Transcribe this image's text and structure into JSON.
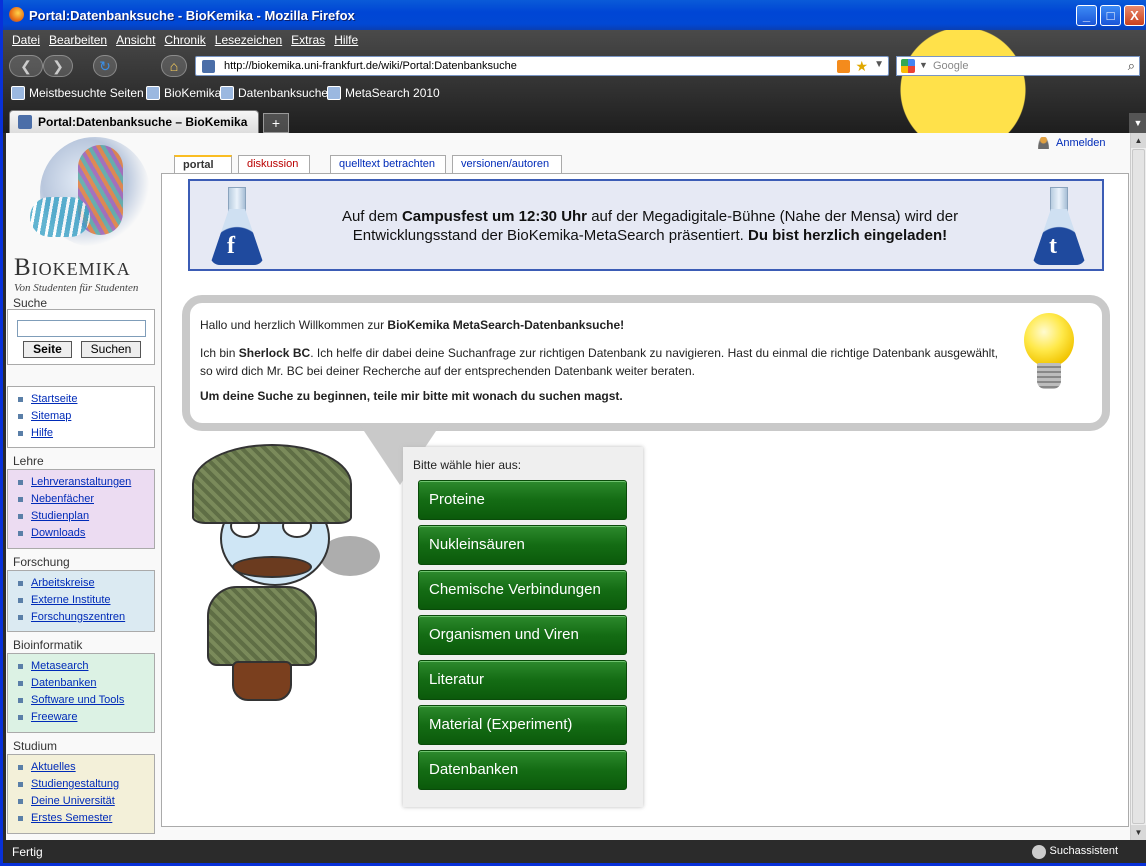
{
  "window": {
    "title": "Portal:Datenbanksuche - BioKemika - Mozilla Firefox",
    "buttons": {
      "minimize": "_",
      "maximize": "□",
      "close": "X"
    }
  },
  "menubar": [
    "Datei",
    "Bearbeiten",
    "Ansicht",
    "Chronik",
    "Lesezeichen",
    "Extras",
    "Hilfe"
  ],
  "navigation": {
    "url": "http://biokemika.uni-frankfurt.de/wiki/Portal:Datenbanksuche",
    "search_placeholder": "Google"
  },
  "bookmarks": [
    "Meistbesuchte Seiten",
    "BioKemika",
    "Datenbanksuche",
    "MetaSearch 2010"
  ],
  "tab": {
    "label": "Portal:Datenbanksuche – BioKemika"
  },
  "status": {
    "left": "Fertig",
    "right": "Suchassistent"
  },
  "page": {
    "user_link": "Anmelden",
    "tabs": [
      "portal",
      "diskussion",
      "quelltext betrachten",
      "versionen/autoren"
    ],
    "logo": {
      "name": "Biokemika",
      "tagline": "Von Studenten für Studenten"
    },
    "search": {
      "heading": "Suche",
      "go": "Seite",
      "search": "Suchen"
    },
    "nav": [
      "Startseite",
      "Sitemap",
      "Hilfe"
    ],
    "sidebar": [
      {
        "title": "Lehre",
        "items": [
          "Lehrveranstaltungen",
          "Nebenfächer",
          "Studienplan",
          "Downloads"
        ],
        "bg": "#ecdcf2"
      },
      {
        "title": "Forschung",
        "items": [
          "Arbeitskreise",
          "Externe Institute",
          "Forschungszentren"
        ],
        "bg": "#dbeaf2"
      },
      {
        "title": "Bioinformatik",
        "items": [
          "Metasearch",
          "Datenbanken",
          "Software und Tools",
          "Freeware"
        ],
        "bg": "#dcf2e4"
      },
      {
        "title": "Studium",
        "items": [
          "Aktuelles",
          "Studiengestaltung",
          "Deine Universität",
          "Erstes Semester"
        ],
        "bg": "#f3f0d9"
      }
    ],
    "banner": {
      "pre": "Auf dem ",
      "bold1": "Campusfest um 12:30 Uhr",
      "mid": " auf der Megadigitale-Bühne (Nahe der Mensa) wird der Entwicklungsstand der BioKemika-MetaSearch präsentiert. ",
      "bold2": "Du bist herzlich eingeladen!",
      "left_icon": "f",
      "right_icon": "t"
    },
    "bubble": {
      "greeting_pre": "Hallo und herzlich Willkommen zur ",
      "greeting_bold": "BioKemika MetaSearch-Datenbanksuche!",
      "intro_pre": "Ich bin ",
      "intro_bold": "Sherlock BC",
      "intro_rest": ". Ich helfe dir dabei deine Suchanfrage zur richtigen Datenbank zu navigieren. Hast du einmal die richtige Datenbank ausgewählt, so wird dich Mr. BC bei deiner Recherche auf der entsprechenden Datenbank weiter beraten.",
      "call": "Um deine Suche zu beginnen, teile mir bitte mit wonach du suchen magst."
    },
    "chooser": {
      "label": "Bitte wähle hier aus:",
      "options": [
        "Proteine",
        "Nukleinsäuren",
        "Chemische Verbindungen",
        "Organismen und Viren",
        "Literatur",
        "Material (Experiment)",
        "Datenbanken"
      ]
    }
  }
}
